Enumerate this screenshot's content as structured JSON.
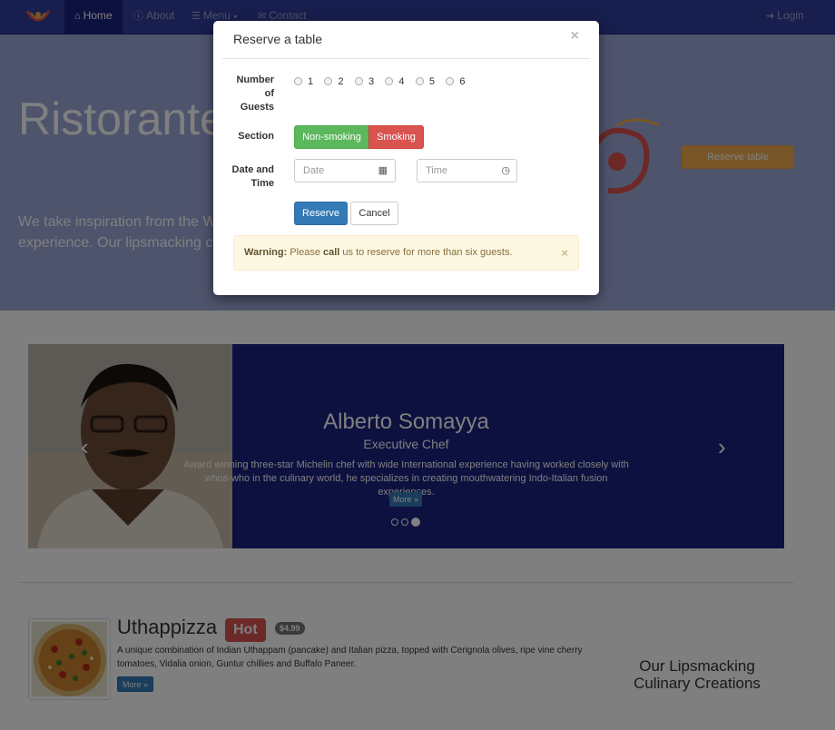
{
  "colors": {
    "nav_bg": "#303f9f",
    "nav_active": "#1a237e",
    "jumbotron_bg": "#9fa8da",
    "carousel_bg": "#1a237e",
    "primary": "#337ab7",
    "success": "#5cb85c",
    "danger": "#d9534f",
    "warning": "#f0ad4e"
  },
  "navbar": {
    "logo_icon": "restaurant-logo",
    "items": [
      {
        "label": "Home",
        "icon": "home-icon"
      },
      {
        "label": "About",
        "icon": "info-icon"
      },
      {
        "label": "Menu",
        "icon": "list-icon"
      },
      {
        "label": "Contact",
        "icon": "envelope-icon"
      }
    ],
    "login": {
      "label": "Login",
      "icon": "login-icon"
    }
  },
  "jumbotron": {
    "title": "Ristorante",
    "text_line1": "We take inspiration from the W",
    "text_line2": "experience. Our lipsmacking cr",
    "reserve_button": "Reserve table"
  },
  "carousel": {
    "name": "Alberto Somayya",
    "role": "Executive Chef",
    "description_line1": "Award winning three-star Michelin chef with wide International experience having worked closely with",
    "description_line2": "whos-who in the culinary world, he specializes in creating mouthwatering Indo-Italian fusion experiences.",
    "more_button": "More »",
    "prev_glyph": "‹",
    "next_glyph": "›"
  },
  "dish": {
    "name": "Uthappizza",
    "badge": "Hot",
    "price": "$4.99",
    "description": "A unique combination of Indian Uthappam (pancake) and Italian pizza, topped with Cerignola olives, ripe vine cherry tomatoes, Vidalia onion, Guntur chillies and Buffalo Paneer.",
    "more_button": "More »"
  },
  "creations_heading": "Our Lipsmacking Culinary Creations",
  "modal": {
    "title": "Reserve a table",
    "close": "×",
    "guests_label_line1": "Number",
    "guests_label_line2": "of",
    "guests_label_line3": "Guests",
    "guest_options": [
      "1",
      "2",
      "3",
      "4",
      "5",
      "6"
    ],
    "section_label": "Section",
    "section_options": {
      "non_smoking": "Non-smoking",
      "smoking": "Smoking"
    },
    "datetime_label_line1": "Date and",
    "datetime_label_line2": "Time",
    "date_placeholder": "Date",
    "time_placeholder": "Time",
    "reserve_button": "Reserve",
    "cancel_button": "Cancel",
    "alert": {
      "strong": "Warning:",
      "text1": " Please ",
      "call": "call",
      "text2": " us to reserve for more than six guests.",
      "close": "×"
    }
  }
}
